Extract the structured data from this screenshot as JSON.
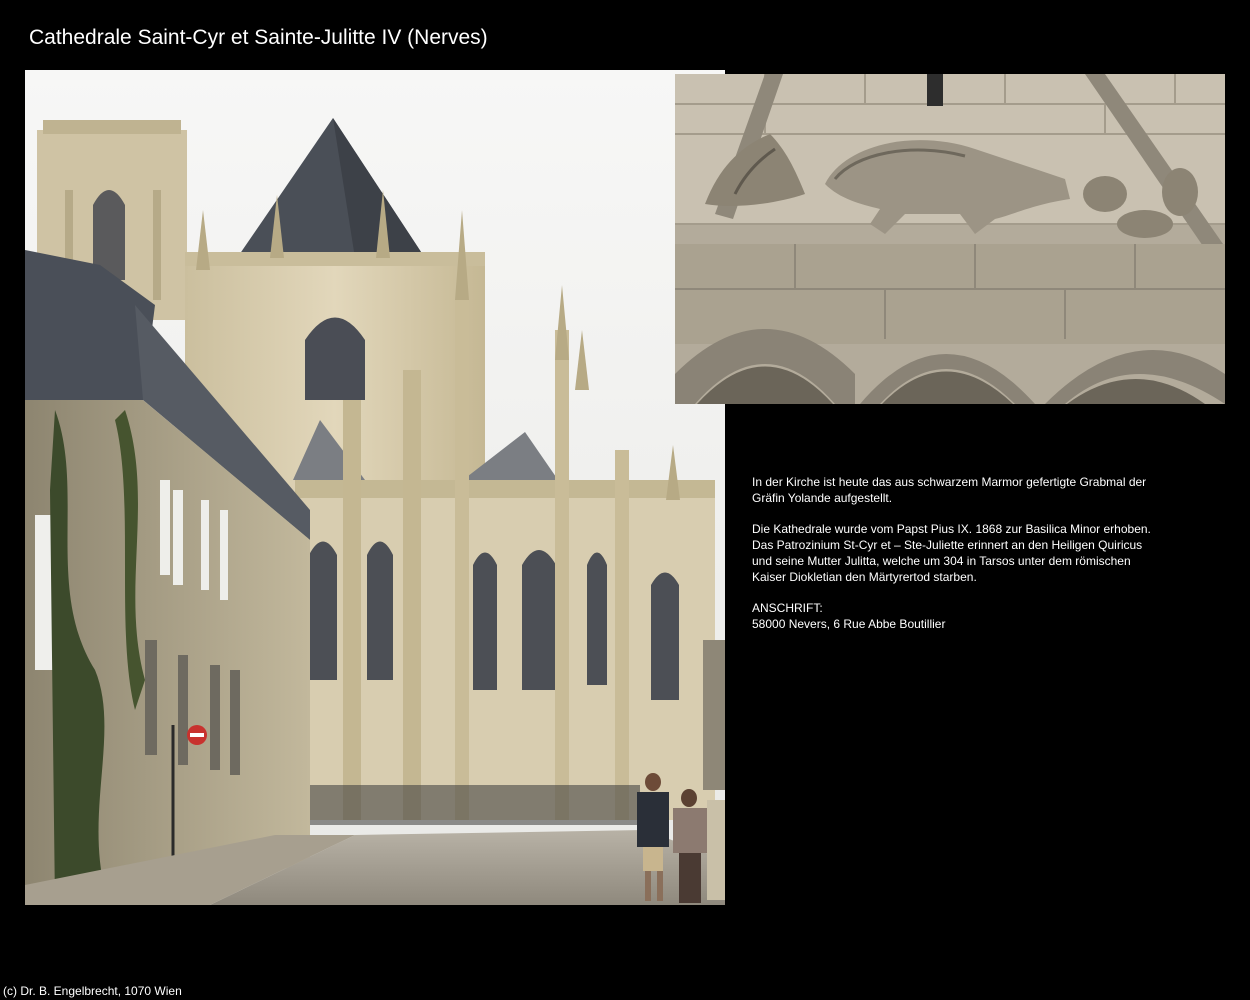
{
  "page": {
    "title": "Cathedrale Saint-Cyr et Sainte-Julitte IV (Nerves)",
    "paragraphs": [
      "In der Kirche ist heute das aus schwarzem Marmor gefertigte Grabmal der\nGräfin Yolande aufgestellt.",
      "Die Kathedrale wurde vom Papst Pius IX. 1868 zur Basilica Minor erhoben.\nDas Patrozinium St-Cyr et – Ste-Juliette erinnert an den Heiligen Quiricus\nund seine Mutter Julitta, welche um 304 in Tarsos unter dem römischen\nKaiser Diokletian den Märtyrertod starben.",
      "ANSCHRIFT:\n58000 Nevers, 6 Rue Abbe Boutillier"
    ],
    "footer": "(c) Dr. B. Engelbrecht, 1070 Wien"
  },
  "colors": {
    "background": "#000000",
    "text": "#ffffff",
    "stone": "#d9cdb0",
    "roof": "#4a4f57",
    "sky": "#f4f4f2"
  }
}
